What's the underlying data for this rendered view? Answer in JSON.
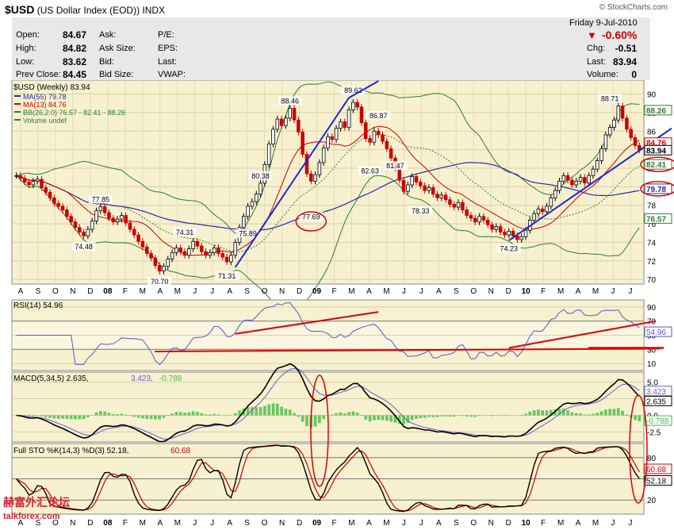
{
  "header": {
    "symbol": "$USD",
    "name": "(US Dollar Index (EOD))",
    "exchange": "INDX",
    "source": "© StockCharts.com"
  },
  "quote": {
    "date": "Friday  9-Jul-2010",
    "pct_change": "-0.60%",
    "rows_left": [
      {
        "label": "Open:",
        "value": "84.67"
      },
      {
        "label": "High:",
        "value": "84.82"
      },
      {
        "label": "Low:",
        "value": "83.62"
      },
      {
        "label": "Prev Close:",
        "value": "84.45"
      }
    ],
    "rows_mid": [
      "Ask:",
      "Ask Size:",
      "Bid:",
      "Bid Size:"
    ],
    "rows_mid2": [
      "P/E:",
      "EPS:",
      "Last:",
      "VWAP:"
    ],
    "rows_right": [
      {
        "label": "Chg:",
        "value": "-0.51"
      },
      {
        "label": "Last:",
        "value": "83.94"
      },
      {
        "label": "Volume:",
        "value": "0"
      }
    ]
  },
  "colors": {
    "panel_bg": "#f7f1cf",
    "price_up": "#000000",
    "price_down": "#cc0000",
    "ma55": "#2a2aa8",
    "ma13": "#cc0000",
    "bb": "#2e7d32",
    "trend": "#1f27cf",
    "rsi": "#5555cc",
    "macd": "#000000",
    "signal": "#6a5acd",
    "hist": "#44bb44",
    "stoK": "#000000",
    "stoD": "#cc0000",
    "annot": "#dd0000"
  },
  "chart_data": [
    {
      "type": "candlestick",
      "title": "$USD (Weekly) 83.94",
      "legend": [
        "MA(55) 79.78",
        "MA(13) 84.76",
        "BB(26,2.0) 76.57 - 82.41 - 88.26",
        "Volume undef"
      ],
      "x_tick_labels": [
        "A",
        "S",
        "O",
        "N",
        "D",
        "08",
        "F",
        "M",
        "A",
        "M",
        "J",
        "J",
        "A",
        "S",
        "O",
        "N",
        "D",
        "09",
        "F",
        "M",
        "A",
        "M",
        "J",
        "J",
        "A",
        "S",
        "O",
        "N",
        "D",
        "10",
        "F",
        "M",
        "A",
        "M",
        "J",
        "J"
      ],
      "y_ticks": [
        70,
        72,
        74,
        76,
        78,
        80,
        82,
        84,
        86,
        88,
        90
      ],
      "ylim": [
        69.5,
        91.5
      ],
      "closes": [
        81.2,
        80.9,
        80.5,
        80.2,
        80.6,
        80.8,
        79.9,
        79.4,
        78.8,
        78.2,
        77.9,
        77.5,
        76.8,
        76.2,
        75.6,
        75.1,
        74.7,
        75.4,
        76.3,
        77.4,
        77.85,
        77.2,
        76.6,
        76.2,
        76.5,
        76.9,
        76.1,
        75.4,
        74.8,
        74.1,
        73.5,
        72.8,
        72.3,
        71.5,
        70.9,
        71.4,
        72.2,
        72.9,
        73.4,
        73.0,
        72.6,
        73.3,
        74.1,
        73.6,
        73.0,
        72.6,
        72.9,
        73.4,
        72.8,
        72.4,
        71.9,
        72.6,
        74.0,
        75.6,
        76.8,
        77.9,
        78.4,
        79.2,
        80.38,
        82.4,
        84.6,
        86.2,
        87.3,
        86.6,
        87.4,
        88.46,
        87.2,
        85.9,
        83.5,
        81.4,
        80.6,
        81.3,
        82.6,
        84.2,
        85.4,
        85.1,
        86.3,
        87.0,
        86.4,
        88.3,
        89.1,
        88.6,
        86.9,
        85.2,
        84.8,
        86.0,
        85.6,
        84.9,
        84.1,
        83.1,
        82.0,
        80.7,
        79.5,
        80.2,
        81.1,
        80.5,
        80.1,
        79.6,
        79.9,
        79.2,
        78.8,
        79.1,
        78.6,
        78.1,
        77.8,
        78.3,
        77.5,
        76.9,
        76.6,
        76.2,
        76.8,
        76.4,
        75.9,
        75.4,
        75.7,
        75.1,
        74.8,
        75.2,
        74.7,
        74.3,
        74.6,
        75.3,
        76.4,
        77.1,
        77.6,
        77.3,
        77.9,
        78.8,
        79.6,
        80.6,
        81.2,
        80.7,
        80.2,
        80.6,
        81.0,
        80.4,
        81.2,
        81.9,
        82.8,
        84.1,
        85.6,
        86.4,
        87.2,
        88.71,
        87.4,
        86.2,
        85.3,
        84.45,
        83.94
      ],
      "annotations": [
        {
          "label": "88.46"
        },
        {
          "label": "89.62"
        },
        {
          "label": "86.87"
        },
        {
          "label": "80.38"
        },
        {
          "label": "82.63"
        },
        {
          "label": "81.47"
        },
        {
          "label": "77.85"
        },
        {
          "label": "74.31"
        },
        {
          "label": "74.48"
        },
        {
          "label": "75.89"
        },
        {
          "label": "77.69"
        },
        {
          "label": "78.33"
        },
        {
          "label": "70.70"
        },
        {
          "label": "71.31"
        },
        {
          "label": "74.23"
        },
        {
          "label": "88.71"
        }
      ],
      "right_labels": [
        "88.26",
        "84.76",
        "83.94",
        "82.41",
        "79.78",
        "76.57"
      ]
    },
    {
      "type": "line",
      "title": "RSI(14) 54.96",
      "y_ticks": [
        10,
        30,
        50,
        70,
        90
      ],
      "ylim": [
        0,
        100
      ],
      "right_label": "54.96"
    },
    {
      "type": "line",
      "title": "MACD(5,34,5) 2.635, 3.423, -0.788",
      "macd_label": "MACD(5,34,5) 2.635,",
      "signal_label": "3.423,",
      "hist_label": "-0.788",
      "y_ticks": [
        5.0,
        2.5,
        0.0,
        -2.5
      ],
      "y_tick_labels": [
        "5.0",
        "2.5",
        "0.0",
        "-2.5"
      ],
      "ylim": [
        -4,
        6.5
      ],
      "right_labels": [
        "3.423",
        "2.635",
        "-0.788"
      ]
    },
    {
      "type": "line",
      "title": "Full STO %K(14,3) %D(3) 52.18, 60.68",
      "sto_label": "Full STO %K(14,3) %D(3) 52.18,",
      "sto_d_label": "60.68",
      "y_ticks": [
        20,
        50,
        80
      ],
      "ylim": [
        0,
        100
      ],
      "right_labels": [
        "60.68",
        "52.18"
      ]
    }
  ],
  "watermark": {
    "cn": "赫富外汇论坛",
    "en": "talkforex.com"
  }
}
